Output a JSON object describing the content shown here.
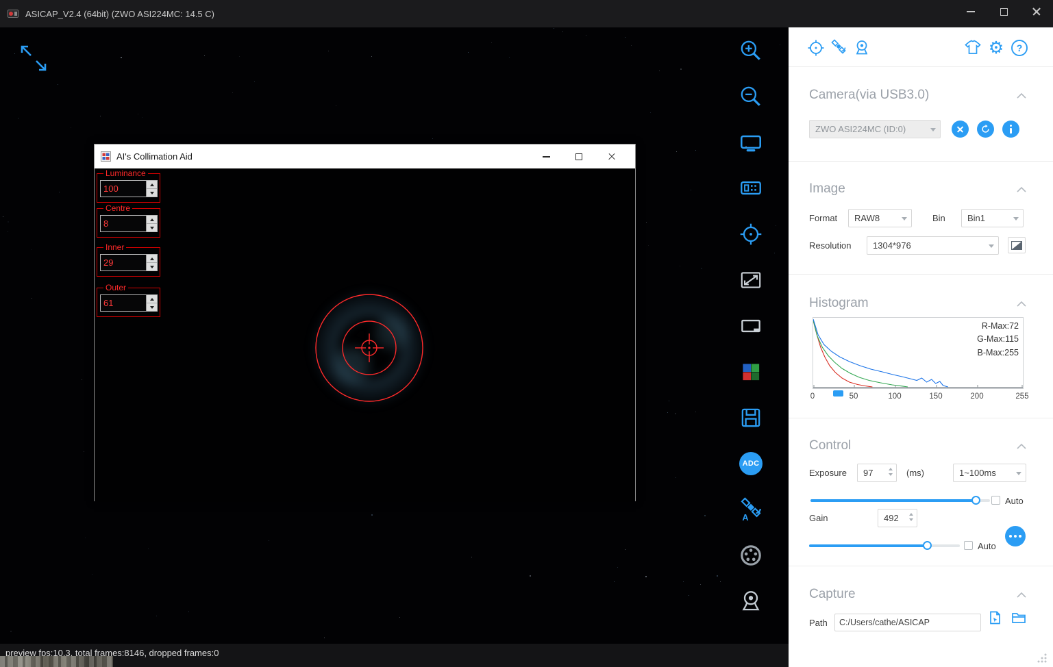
{
  "titlebar": {
    "title": "ASICAP_V2.4 (64bit) (ZWO ASI224MC: 14.5 C)"
  },
  "statusbar": {
    "text": "preview fps:10.3, total frames:8146, dropped frames:0"
  },
  "collimation": {
    "title": "AI's Collimation Aid",
    "fields": [
      {
        "label": "Luminance",
        "value": "100"
      },
      {
        "label": "Centre",
        "value": "8"
      },
      {
        "label": "Inner",
        "value": "29"
      },
      {
        "label": "Outer",
        "value": "61"
      }
    ]
  },
  "toolbar": {
    "adc_label": "ADC"
  },
  "panel": {
    "camera": {
      "title": "Camera(via USB3.0)",
      "device": "ZWO ASI224MC (ID:0)"
    },
    "image": {
      "title": "Image",
      "format_label": "Format",
      "format": "RAW8",
      "bin_label": "Bin",
      "bin": "Bin1",
      "resolution_label": "Resolution",
      "resolution": "1304*976"
    },
    "histogram": {
      "title": "Histogram",
      "r_max": "R-Max:72",
      "g_max": "G-Max:115",
      "b_max": "B-Max:255"
    },
    "control": {
      "title": "Control",
      "exposure_label": "Exposure",
      "exposure_value": "97",
      "exposure_unit": "(ms)",
      "exposure_range": "1~100ms",
      "auto_label": "Auto",
      "gain_label": "Gain",
      "gain_value": "492"
    },
    "capture": {
      "title": "Capture",
      "path_label": "Path",
      "path_value": "C:/Users/cathe/ASICAP"
    }
  },
  "chart_data": {
    "type": "line",
    "title": "Histogram",
    "xlim": [
      0,
      255
    ],
    "x_ticks": [
      "0",
      "50",
      "100",
      "150",
      "200",
      "255"
    ],
    "annotations": [
      "R-Max:72",
      "G-Max:115",
      "B-Max:255"
    ],
    "series": [
      {
        "name": "R",
        "color": "#d93025",
        "points": [
          [
            0,
            0.97
          ],
          [
            4,
            0.78
          ],
          [
            9,
            0.58
          ],
          [
            14,
            0.44
          ],
          [
            20,
            0.31
          ],
          [
            27,
            0.21
          ],
          [
            35,
            0.13
          ],
          [
            44,
            0.07
          ],
          [
            54,
            0.035
          ],
          [
            63,
            0.015
          ],
          [
            72,
            0.0
          ]
        ]
      },
      {
        "name": "G",
        "color": "#34a853",
        "points": [
          [
            0,
            0.97
          ],
          [
            5,
            0.74
          ],
          [
            11,
            0.58
          ],
          [
            18,
            0.46
          ],
          [
            26,
            0.36
          ],
          [
            35,
            0.27
          ],
          [
            45,
            0.2
          ],
          [
            56,
            0.14
          ],
          [
            68,
            0.095
          ],
          [
            82,
            0.06
          ],
          [
            96,
            0.03
          ],
          [
            108,
            0.012
          ],
          [
            115,
            0.0
          ]
        ]
      },
      {
        "name": "B",
        "color": "#1a73e8",
        "points": [
          [
            0,
            0.99
          ],
          [
            6,
            0.76
          ],
          [
            13,
            0.62
          ],
          [
            22,
            0.52
          ],
          [
            32,
            0.44
          ],
          [
            44,
            0.37
          ],
          [
            57,
            0.31
          ],
          [
            70,
            0.26
          ],
          [
            84,
            0.22
          ],
          [
            97,
            0.18
          ],
          [
            108,
            0.15
          ],
          [
            118,
            0.12
          ],
          [
            126,
            0.095
          ],
          [
            132,
            0.13
          ],
          [
            138,
            0.07
          ],
          [
            144,
            0.11
          ],
          [
            149,
            0.05
          ],
          [
            154,
            0.08
          ],
          [
            158,
            0.02
          ],
          [
            164,
            0.0
          ]
        ]
      }
    ]
  }
}
